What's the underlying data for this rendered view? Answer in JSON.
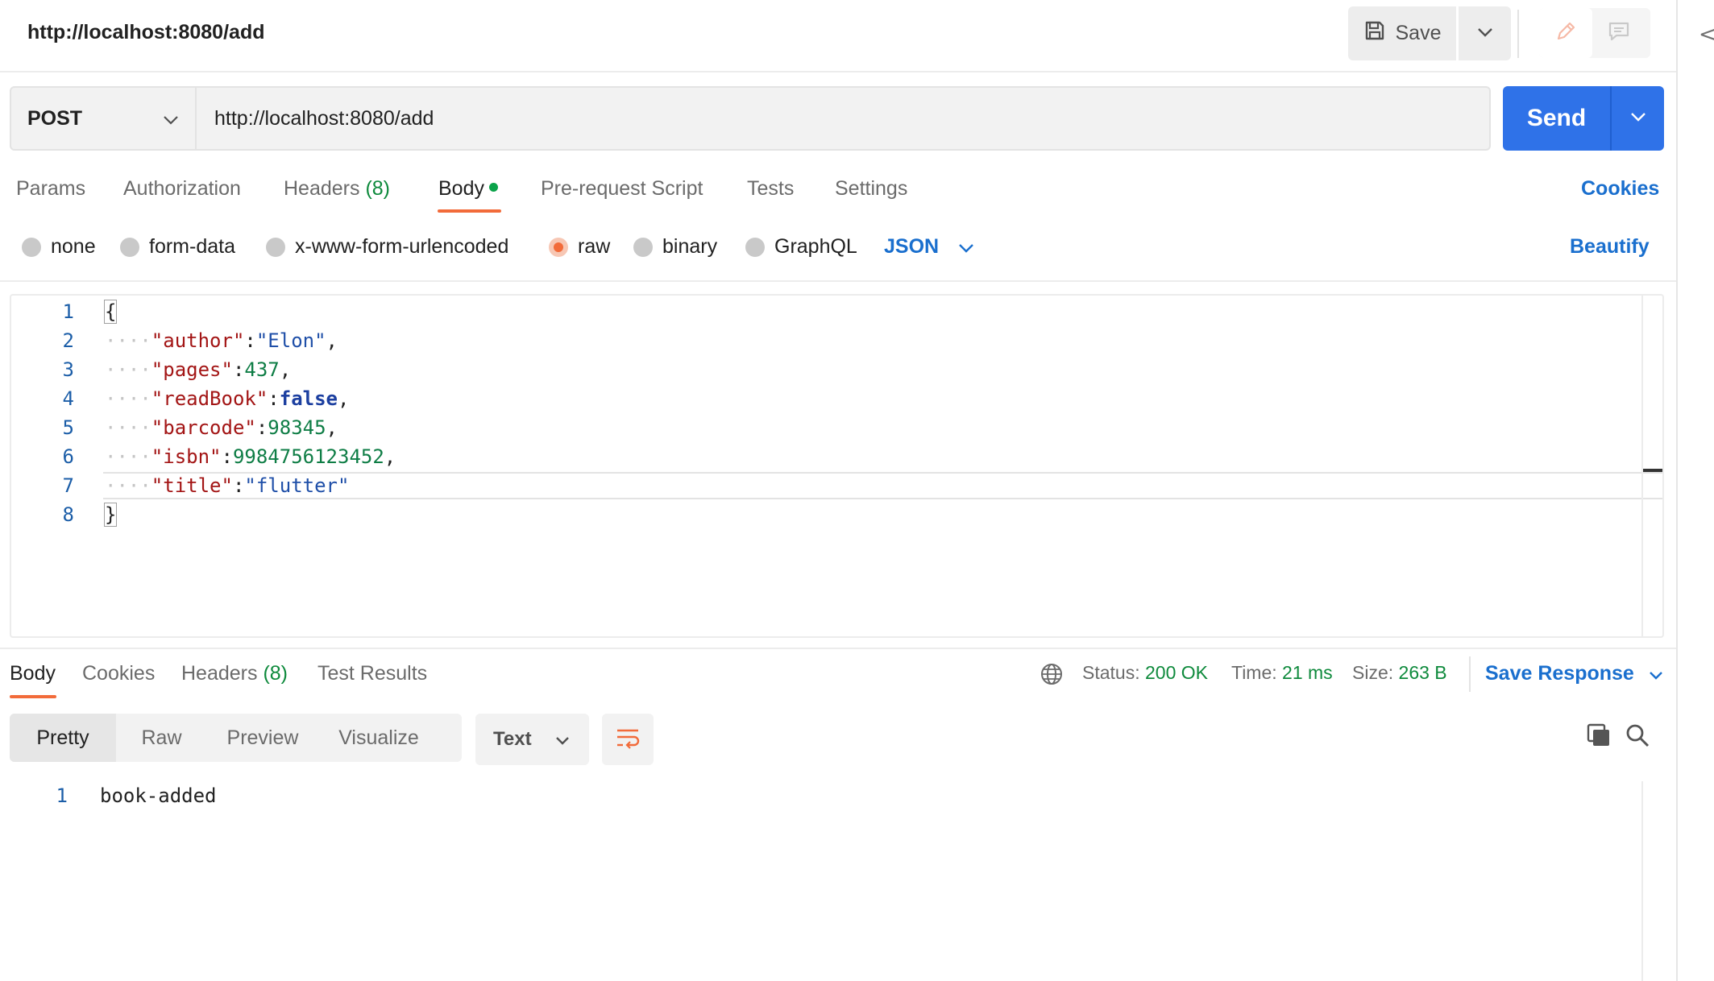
{
  "tab": {
    "title": "http://localhost:8080/add"
  },
  "toolbar": {
    "save_label": "Save",
    "side_glyph": "</"
  },
  "request": {
    "method": "POST",
    "url": "http://localhost:8080/add",
    "send_label": "Send"
  },
  "request_tabs": [
    {
      "label": "Params"
    },
    {
      "label": "Authorization"
    },
    {
      "label": "Headers",
      "count": "(8)"
    },
    {
      "label": "Body"
    },
    {
      "label": "Pre-request Script"
    },
    {
      "label": "Tests"
    },
    {
      "label": "Settings"
    }
  ],
  "cookies_label": "Cookies",
  "body_types": [
    {
      "label": "none"
    },
    {
      "label": "form-data"
    },
    {
      "label": "x-www-form-urlencoded"
    },
    {
      "label": "raw",
      "selected": true
    },
    {
      "label": "binary"
    },
    {
      "label": "GraphQL"
    }
  ],
  "body_format": "JSON",
  "beautify_label": "Beautify",
  "editor": {
    "line_numbers": [
      "1",
      "2",
      "3",
      "4",
      "5",
      "6",
      "7",
      "8"
    ],
    "lines": [
      {
        "tokens": [
          "{"
        ]
      },
      {
        "tokens": [
          "····",
          "\"author\"",
          ":",
          "\"Elon\"",
          ","
        ]
      },
      {
        "tokens": [
          "····",
          "\"pages\"",
          ":",
          "437",
          ","
        ]
      },
      {
        "tokens": [
          "····",
          "\"readBook\"",
          ":",
          "false",
          ","
        ]
      },
      {
        "tokens": [
          "····",
          "\"barcode\"",
          ":",
          "98345",
          ","
        ]
      },
      {
        "tokens": [
          "····",
          "\"isbn\"",
          ":",
          "9984756123452",
          ","
        ]
      },
      {
        "tokens": [
          "····",
          "\"title\"",
          ":",
          "\"flutter\""
        ]
      },
      {
        "tokens": [
          "}"
        ]
      }
    ]
  },
  "response_tabs": [
    {
      "label": "Body"
    },
    {
      "label": "Cookies"
    },
    {
      "label": "Headers",
      "count": "(8)"
    },
    {
      "label": "Test Results"
    }
  ],
  "response_status": {
    "status_label": "Status:",
    "status_value": "200 OK",
    "time_label": "Time:",
    "time_value": "21 ms",
    "size_label": "Size:",
    "size_value": "263 B"
  },
  "save_response_label": "Save Response",
  "response_views": [
    "Pretty",
    "Raw",
    "Preview",
    "Visualize"
  ],
  "response_format": "Text",
  "response_body": {
    "line_number": "1",
    "text": "book-added"
  },
  "colors": {
    "accent": "#f26b3a",
    "primary": "#2f72e8",
    "link": "#1a6fce",
    "success": "#0e8a3c"
  }
}
